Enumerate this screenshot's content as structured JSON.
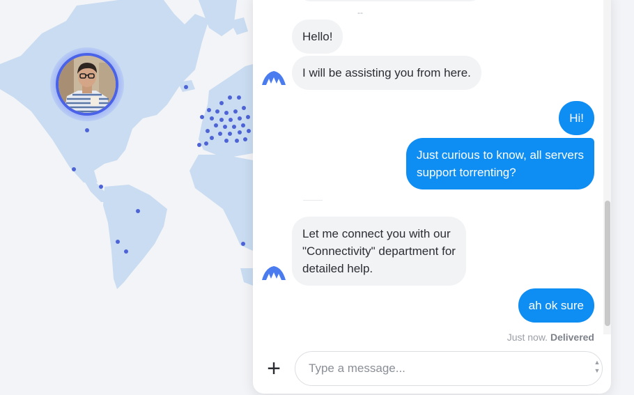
{
  "map": {
    "land_color": "#c9dcf1",
    "dot_color": "#4d63d6",
    "avatar_ring_color": "#4a62e8"
  },
  "chat": {
    "top_marker": "--",
    "messages": [
      {
        "from": "agent",
        "text": "Hello!"
      },
      {
        "from": "agent",
        "text": "I will be assisting you from here."
      },
      {
        "from": "user",
        "text": "Hi!"
      },
      {
        "from": "user",
        "lines": [
          "Just curious to know, all servers",
          "support torrenting?"
        ]
      },
      {
        "from": "agent",
        "lines": [
          "Let me connect you with our",
          "\"Connectivity\" department for",
          "detailed help."
        ]
      },
      {
        "from": "user",
        "text": "ah ok sure"
      }
    ],
    "status": {
      "time": "Just now.",
      "state": "Delivered"
    },
    "composer": {
      "add_label": "+",
      "placeholder": "Type a message...",
      "spinner_up": "▲",
      "spinner_down": "▼"
    },
    "colors": {
      "user_bubble": "#0e8df2",
      "agent_bubble": "#f2f3f5",
      "logo": "#4a7cf0"
    }
  }
}
